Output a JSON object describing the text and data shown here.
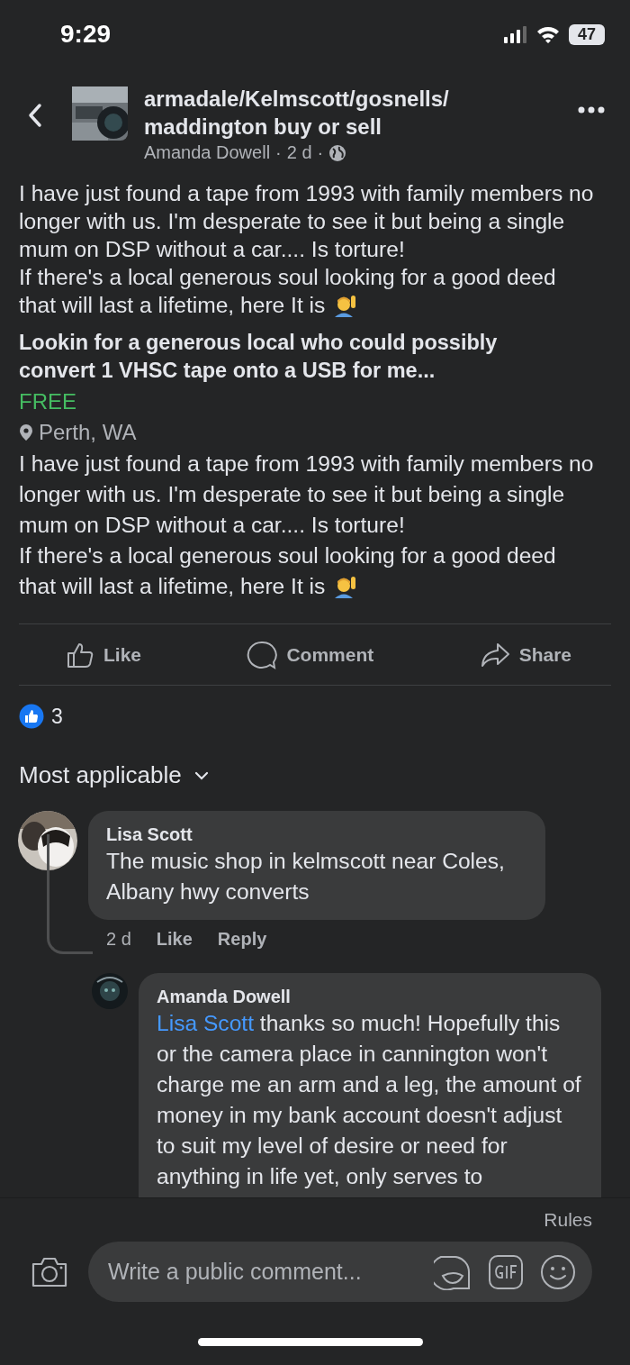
{
  "status_bar": {
    "time": "9:29",
    "battery": "47"
  },
  "header": {
    "title_lines": [
      "armadale/Kelmscott/gosnells/",
      "maddington buy or sell"
    ],
    "author": "Amanda Dowell",
    "separator": "·",
    "time": "2 d"
  },
  "post": {
    "paragraphs": [
      "I have just found a tape from 1993 with family members no longer with us. I'm desperate to see it but being a single mum on DSP without a car.... Is torture!",
      "If there's a local generous soul looking for a good deed that will last a lifetime, here It is"
    ]
  },
  "listing": {
    "title": "Lookin for a generous local who could possibly convert 1 VHSC tape onto a USB for me...",
    "price": "FREE",
    "location": "Perth, WA",
    "paragraphs": [
      "I have just found a tape from 1993 with family members no longer with us. I'm desperate to see it but being a single mum on DSP without a car.... Is torture!",
      "If there's a local generous soul looking for a good deed that will last a lifetime, here It is"
    ]
  },
  "actions": [
    {
      "kind": "like",
      "label": "Like"
    },
    {
      "kind": "comment",
      "label": "Comment"
    },
    {
      "kind": "share",
      "label": "Share"
    }
  ],
  "reactions": {
    "count": "3"
  },
  "sort": "Most applicable",
  "comments": [
    {
      "author": "Lisa Scott",
      "text": "The music shop in kelmscott near Coles, Albany hwy converts",
      "time": "2 d",
      "actions": [
        "Like",
        "Reply"
      ],
      "replies": [
        {
          "author": "Amanda Dowell",
          "mention": "Lisa Scott",
          "text": "thanks so much! Hopefully this or the camera place in cannington won't charge me an arm and a leg, the amount of money in my bank account doesn't adjust to suit my level of desire or need for anything in life yet, only serves to"
        }
      ]
    }
  ],
  "composer": {
    "rules": "Rules",
    "placeholder": "Write a public comment..."
  }
}
